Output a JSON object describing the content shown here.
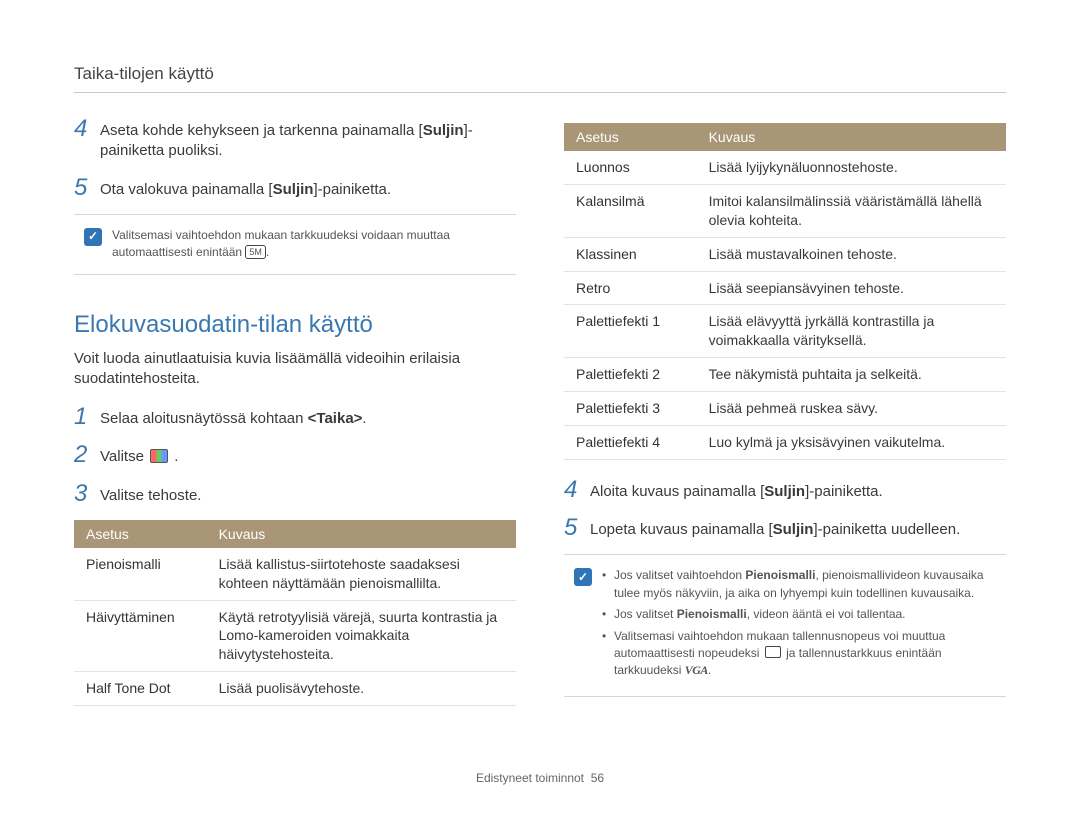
{
  "header": {
    "title": "Taika-tilojen käyttö"
  },
  "left": {
    "step4_pre": "Aseta kohde kehykseen ja tarkenna painamalla [",
    "step4_bold1": "Suljin",
    "step4_post": "]-painiketta puoliksi.",
    "step5_pre": "Ota valokuva painamalla [",
    "step5_bold1": "Suljin",
    "step5_post": "]-painiketta.",
    "note1_text": "Valitsemasi vaihtoehdon mukaan tarkkuudeksi voidaan muuttaa automaattisesti enintään ",
    "note1_badge": "5M",
    "h2": "Elokuvasuodatin-tilan käyttö",
    "intro": "Voit luoda ainutlaatuisia kuvia lisäämällä videoihin erilaisia suodatintehosteita.",
    "s1_pre": "Selaa aloitusnäytössä kohtaan ",
    "s1_bold": "<Taika>",
    "s1_post": ".",
    "s2_pre": "Valitse ",
    "s2_post": " .",
    "s3": "Valitse tehoste.",
    "table": {
      "h1": "Asetus",
      "h2": "Kuvaus",
      "rows": [
        {
          "a": "Pienoismalli",
          "k": "Lisää kallistus-siirtotehoste saadaksesi kohteen näyttämään pienoismallilta."
        },
        {
          "a": "Häivyttäminen",
          "k": "Käytä retrotyylisiä värejä, suurta kontrastia ja Lomo-kameroiden voimakkaita häivytystehosteita."
        },
        {
          "a": "Half Tone Dot",
          "k": "Lisää puolisävytehoste."
        }
      ]
    }
  },
  "right": {
    "table": {
      "h1": "Asetus",
      "h2": "Kuvaus",
      "rows": [
        {
          "a": "Luonnos",
          "k": "Lisää lyijykynäluonnostehoste."
        },
        {
          "a": "Kalansilmä",
          "k": "Imitoi kalansilmälinssiä vääristämällä lähellä olevia kohteita."
        },
        {
          "a": "Klassinen",
          "k": "Lisää mustavalkoinen tehoste."
        },
        {
          "a": "Retro",
          "k": "Lisää seepiansävyinen tehoste."
        },
        {
          "a": "Palettiefekti 1",
          "k": "Lisää elävyyttä jyrkällä kontrastilla ja voimakkaalla värityksellä."
        },
        {
          "a": "Palettiefekti 2",
          "k": "Tee näkymistä puhtaita ja selkeitä."
        },
        {
          "a": "Palettiefekti 3",
          "k": "Lisää pehmeä ruskea sävy."
        },
        {
          "a": "Palettiefekti 4",
          "k": "Luo kylmä ja yksisävyinen vaikutelma."
        }
      ]
    },
    "step4_pre": "Aloita kuvaus painamalla [",
    "step4_bold": "Suljin",
    "step4_post": "]-painiketta.",
    "step5_pre": "Lopeta kuvaus painamalla [",
    "step5_bold": "Suljin",
    "step5_post": "]-painiketta uudelleen.",
    "note": {
      "li1_a": "Jos valitset vaihtoehdon ",
      "li1_b": "Pienoismalli",
      "li1_c": ", pienoismallivideon kuvausaika tulee myös näkyviin, ja aika on lyhyempi kuin todellinen kuvausaika.",
      "li2_a": "Jos valitset ",
      "li2_b": "Pienoismalli",
      "li2_c": ", videon ääntä ei voi tallentaa.",
      "li3_a": "Valitsemasi vaihtoehdon mukaan tallennusnopeus voi muuttua automaattisesti nopeudeksi ",
      "li3_b": " ja tallennustarkkuus enintään tarkkuudeksi ",
      "li3_vga": "VGA",
      "li3_c": "."
    }
  },
  "footer": {
    "section": "Edistyneet toiminnot",
    "page": "56"
  }
}
